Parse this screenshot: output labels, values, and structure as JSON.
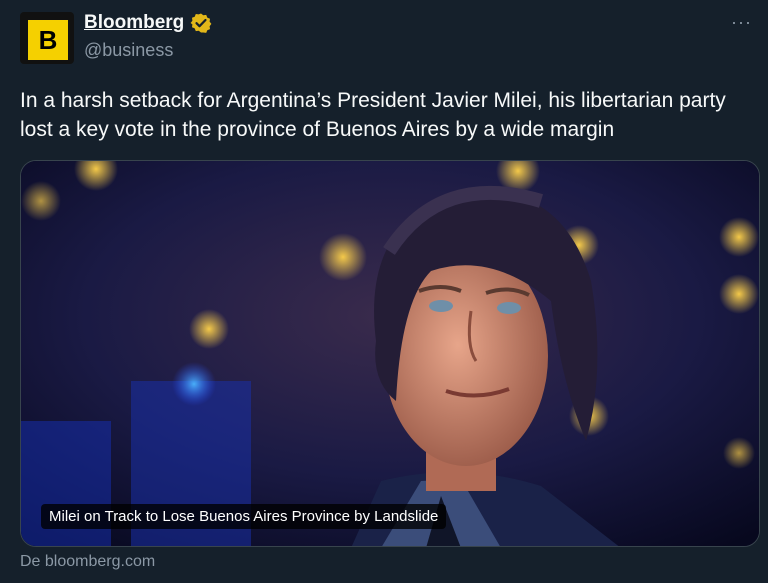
{
  "author": {
    "display_name": "Bloomberg",
    "handle": "@business",
    "avatar_letter": "B",
    "verified": true,
    "verified_color": "#e2b719"
  },
  "menu": {
    "more_label": "···"
  },
  "tweet": {
    "text": "In a harsh setback for Argentina’s President Javier Milei, his libertarian party lost a key vote in the province of Buenos Aires by a wide margin"
  },
  "card": {
    "image_icon": "photo-of-man",
    "headline": "Milei on Track to Lose Buenos Aires Province by Landslide",
    "source": "De bloomberg.com"
  },
  "colors": {
    "background": "#15202b",
    "text": "#f7f9f9",
    "secondary": "#8b98a5",
    "brand": "#f5d000"
  }
}
